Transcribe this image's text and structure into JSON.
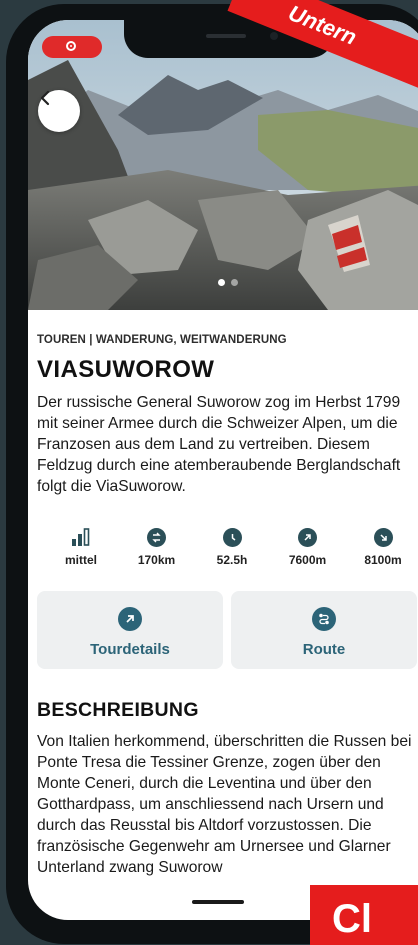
{
  "colors": {
    "accent": "#2c6478",
    "stat_icon": "#2b4f58",
    "banner_red": "#e51d1d",
    "button_bg": "#eef0f1"
  },
  "hero": {
    "back_icon": "chevron-left-icon",
    "carousel_pages": 2,
    "carousel_active": 1
  },
  "banner": {
    "text": "Untern"
  },
  "cta": {
    "text": "Cl"
  },
  "tour": {
    "category": "TOUREN | WANDERUNG, WEITWANDERUNG",
    "title": "VIASUWOROW",
    "intro": "Der russische General Suworow zog im Herbst 1799 mit seiner Armee durch die Schweizer Alpen, um die Franzosen aus dem Land zu vertreiben. Diesem Feldzug durch eine atemberaubende Berglandschaft folgt die ViaSuworow."
  },
  "stats": [
    {
      "icon": "difficulty-bars-icon",
      "value": "mittel"
    },
    {
      "icon": "distance-icon",
      "value": "170km"
    },
    {
      "icon": "clock-icon",
      "value": "52.5h"
    },
    {
      "icon": "ascent-arrow-icon",
      "value": "7600m"
    },
    {
      "icon": "descent-arrow-icon",
      "value": "8100m"
    }
  ],
  "actions": {
    "details_label": "Tourdetails",
    "route_label": "Route"
  },
  "description": {
    "heading": "BESCHREIBUNG",
    "text": "Von Italien herkommend, überschritten die Russen bei Ponte Tresa die Tessiner Grenze, zogen über den Monte Ceneri, durch die Leventina und über den Gotthardpass, um anschliessend nach Ursern und durch das Reusstal bis Altdorf vorzustossen. Die französische Gegenwehr am Urnersee und Glarner Unterland zwang Suworow"
  }
}
